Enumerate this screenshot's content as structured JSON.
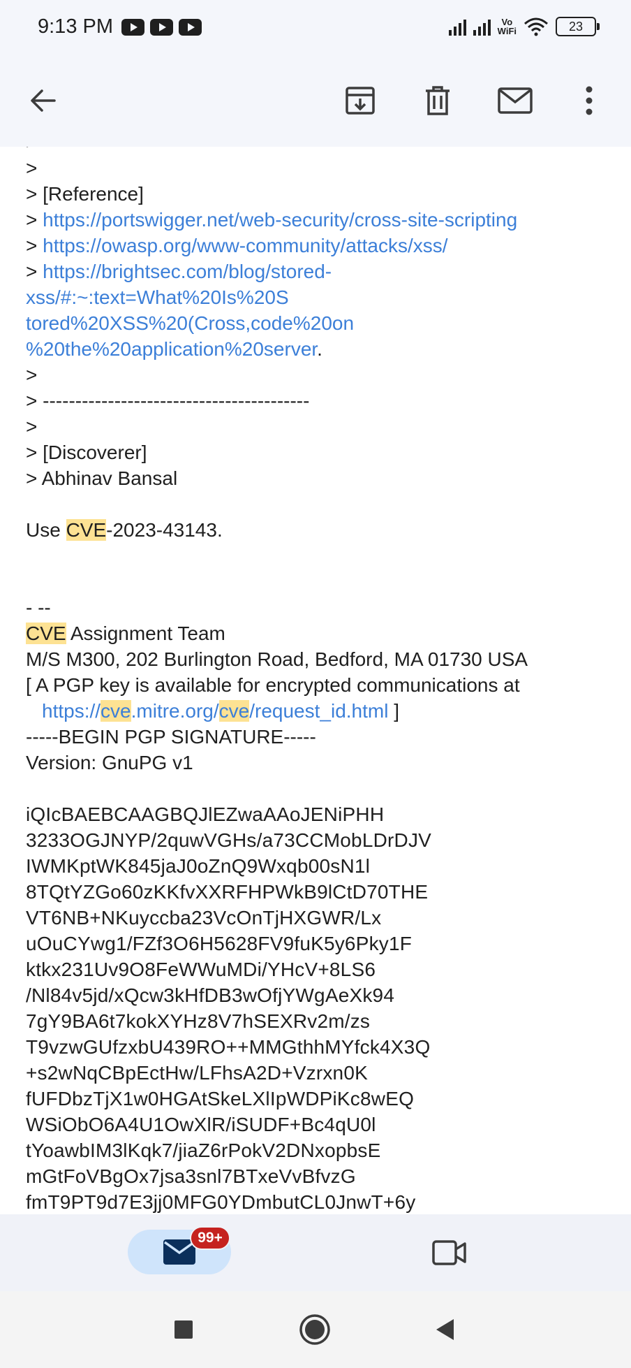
{
  "status_bar": {
    "time": "9:13 PM",
    "notification_icons": [
      "youtube-icon",
      "youtube-icon",
      "youtube-icon"
    ],
    "vowifi_top": "Vo",
    "vowifi_bottom": "WiFi",
    "battery": "23"
  },
  "toolbar": {
    "icons": [
      "back-arrow-icon",
      "archive-icon",
      "delete-icon",
      "mark-unread-icon",
      "more-vert-icon"
    ]
  },
  "email": {
    "lines": [
      {
        "prefix": "> ",
        "text": "-----------------------------------------"
      },
      {
        "prefix": ">",
        "text": ""
      },
      {
        "prefix": "> ",
        "text": "[Reference]"
      },
      {
        "prefix": "> ",
        "link": "https://portswigger.net/web-security/cross-site-scripting"
      },
      {
        "prefix": "> ",
        "link": "https://owasp.org/www-community/attacks/xss/"
      },
      {
        "prefix": "> ",
        "link": "https://brightsec.com/blog/stored-"
      },
      {
        "prefix": "",
        "link": "xss/#:~:text=What%20Is%20S"
      },
      {
        "prefix": "",
        "link": "tored%20XSS%20(Cross,code%20on"
      },
      {
        "prefix": "",
        "link": "%20the%20application%20server",
        "suffix": "."
      },
      {
        "prefix": ">",
        "text": ""
      },
      {
        "prefix": "> ",
        "text": "-----------------------------------------"
      },
      {
        "prefix": ">",
        "text": ""
      },
      {
        "prefix": "> ",
        "text": "[Discoverer]"
      },
      {
        "prefix": "> ",
        "text": "Abhinav Bansal"
      }
    ],
    "use_cve": {
      "highlight": "CVE",
      "rest": "-2023-43143."
    },
    "sig_separator": "- --",
    "team": {
      "highlight": "CVE",
      "rest": " Assignment Team"
    },
    "address": "M/S M300, 202 Burlington Road, Bedford, MA 01730 USA",
    "pgp_note": " [ A PGP key is available for encrypted communications at",
    "pgp_link": {
      "part1": "https://",
      "hl1": "cve",
      "part2": ".mitre.org/",
      "hl2": "cve",
      "part3": "/request_id.html",
      "close": " ]"
    },
    "pgp_begin": "-----BEGIN PGP SIGNATURE-----",
    "pgp_version": "Version: GnuPG v1",
    "signature_lines": [
      "iQIcBAEBCAAGBQJlEZwaAAoJENiPHH",
      "3233OGJNYP/2quwVGHs/a73CCMobLDrDJV",
      "IWMKptWK845jaJ0oZnQ9Wxqb00sN1l",
      "8TQtYZGo60zKKfvXXRFHPWkB9lCtD70THE",
      "VT6NB+NKuyccba23VcOnTjHXGWR/Lx",
      "uOuCYwg1/FZf3O6H5628FV9fuK5y6Pky1F",
      "ktkx231Uv9O8FeWWuMDi/YHcV+8LS6",
      "/Nl84v5jd/xQcw3kHfDB3wOfjYWgAeXk94",
      "7gY9BA6t7kokXYHz8V7hSEXRv2m/zs",
      "T9vzwGUfzxbU439RO++MMGthhMYfck4X3Q",
      "+s2wNqCBpEctHw/LFhsA2D+Vzrxn0K",
      "fUFDbzTjX1w0HGAtSkeLXlIpWDPiKc8wEQ",
      "WSiObO6A4U1OwXlR/iSUDF+Bc4qU0l",
      "tYoawbIM3lKqk7/jiaZ6rPokV2DNxopbsE",
      "mGtFoVBgOx7jsa3snl7BTxeVvBfvzG",
      "fmT9PT9d7E3jj0MFG0YDmbutCL0JnwT+6y"
    ]
  },
  "bottom_nav": {
    "mail_badge": "99+",
    "icons": [
      "mail-icon",
      "video-camera-icon"
    ]
  },
  "system_nav": {
    "icons": [
      "recents-square-icon",
      "home-circle-icon",
      "back-triangle-icon"
    ]
  }
}
